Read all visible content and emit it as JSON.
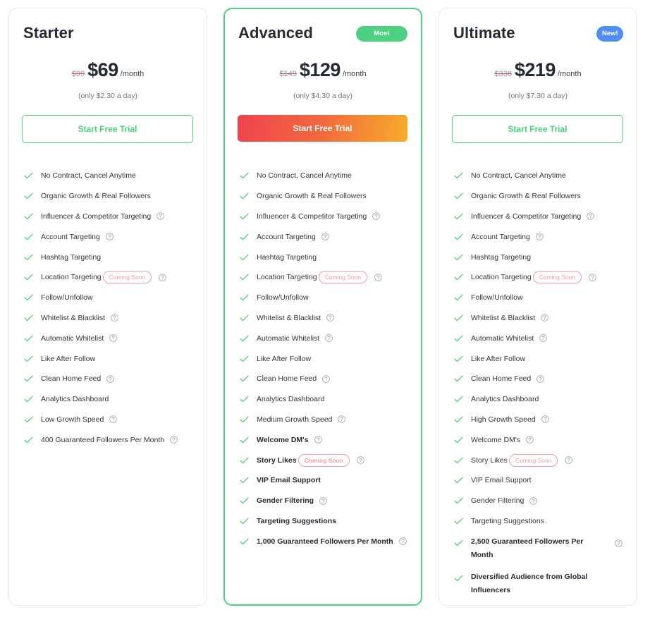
{
  "colors": {
    "accent_green": "#4cd180",
    "badge_blue": "#4f8ef7",
    "cta_gradient": [
      "#f0424f",
      "#f36a3c",
      "#f7ad2b"
    ],
    "coming_soon": "#f29aa3",
    "strike": "#e0445a"
  },
  "labels": {
    "coming_soon": "Coming Soon",
    "per_month": "/month",
    "cta": "Start Free Trial"
  },
  "plans": [
    {
      "name": "Starter",
      "badge": null,
      "old_price": "$99",
      "price": "$69",
      "per": "/month",
      "per_day": "(only $2.30 a day)",
      "cta": "Start Free Trial",
      "featured": false,
      "features": [
        {
          "text": "No Contract, Cancel Anytime",
          "bold": false,
          "help": false,
          "coming_soon": false
        },
        {
          "text": "Organic Growth & Real Followers",
          "bold": false,
          "help": false,
          "coming_soon": false
        },
        {
          "text": "Influencer & Competitor Targeting",
          "bold": false,
          "help": true,
          "coming_soon": false
        },
        {
          "text": "Account Targeting",
          "bold": false,
          "help": true,
          "coming_soon": false
        },
        {
          "text": "Hashtag Targeting",
          "bold": false,
          "help": false,
          "coming_soon": false
        },
        {
          "text": "Location Targeting",
          "bold": false,
          "help": true,
          "coming_soon": true
        },
        {
          "text": "Follow/Unfollow",
          "bold": false,
          "help": false,
          "coming_soon": false
        },
        {
          "text": "Whitelist & Blacklist",
          "bold": false,
          "help": true,
          "coming_soon": false
        },
        {
          "text": "Automatic Whitelist",
          "bold": false,
          "help": true,
          "coming_soon": false
        },
        {
          "text": "Like After Follow",
          "bold": false,
          "help": false,
          "coming_soon": false
        },
        {
          "text": "Clean Home Feed",
          "bold": false,
          "help": true,
          "coming_soon": false
        },
        {
          "text": "Analytics Dashboard",
          "bold": false,
          "help": false,
          "coming_soon": false
        },
        {
          "text": "Low Growth Speed",
          "bold": false,
          "help": true,
          "coming_soon": false
        },
        {
          "text": "400 Guaranteed Followers Per Month",
          "bold": false,
          "help": true,
          "coming_soon": false
        }
      ]
    },
    {
      "name": "Advanced",
      "badge": {
        "text": "Most popular",
        "type": "popular"
      },
      "old_price": "$149",
      "price": "$129",
      "per": "/month",
      "per_day": "(only $4.30 a day)",
      "cta": "Start Free Trial",
      "featured": true,
      "features": [
        {
          "text": "No Contract, Cancel Anytime",
          "bold": false,
          "help": false,
          "coming_soon": false
        },
        {
          "text": "Organic Growth & Real Followers",
          "bold": false,
          "help": false,
          "coming_soon": false
        },
        {
          "text": "Influencer & Competitor Targeting",
          "bold": false,
          "help": true,
          "coming_soon": false
        },
        {
          "text": "Account Targeting",
          "bold": false,
          "help": true,
          "coming_soon": false
        },
        {
          "text": "Hashtag Targeting",
          "bold": false,
          "help": false,
          "coming_soon": false
        },
        {
          "text": "Location Targeting",
          "bold": false,
          "help": true,
          "coming_soon": true
        },
        {
          "text": "Follow/Unfollow",
          "bold": false,
          "help": false,
          "coming_soon": false
        },
        {
          "text": "Whitelist & Blacklist",
          "bold": false,
          "help": true,
          "coming_soon": false
        },
        {
          "text": "Automatic Whitelist",
          "bold": false,
          "help": true,
          "coming_soon": false
        },
        {
          "text": "Like After Follow",
          "bold": false,
          "help": false,
          "coming_soon": false
        },
        {
          "text": "Clean Home Feed",
          "bold": false,
          "help": true,
          "coming_soon": false
        },
        {
          "text": "Analytics Dashboard",
          "bold": false,
          "help": false,
          "coming_soon": false
        },
        {
          "text": "Medium Growth Speed",
          "bold": false,
          "help": true,
          "coming_soon": false
        },
        {
          "text": "Welcome DM's",
          "bold": true,
          "help": true,
          "coming_soon": false
        },
        {
          "text": "Story Likes",
          "bold": true,
          "help": true,
          "coming_soon": true
        },
        {
          "text": "VIP Email Support",
          "bold": true,
          "help": false,
          "coming_soon": false
        },
        {
          "text": "Gender Filtering",
          "bold": true,
          "help": true,
          "coming_soon": false
        },
        {
          "text": "Targeting Suggestions",
          "bold": true,
          "help": false,
          "coming_soon": false
        },
        {
          "text": "1,000 Guaranteed Followers Per Month",
          "bold": true,
          "help": true,
          "coming_soon": false
        }
      ]
    },
    {
      "name": "Ultimate",
      "badge": {
        "text": "New!",
        "type": "new"
      },
      "old_price": "$338",
      "price": "$219",
      "per": "/month",
      "per_day": "(only $7.30 a day)",
      "cta": "Start Free Trial",
      "featured": false,
      "features": [
        {
          "text": "No Contract, Cancel Anytime",
          "bold": false,
          "help": false,
          "coming_soon": false
        },
        {
          "text": "Organic Growth & Real Followers",
          "bold": false,
          "help": false,
          "coming_soon": false
        },
        {
          "text": "Influencer & Competitor Targeting",
          "bold": false,
          "help": true,
          "coming_soon": false
        },
        {
          "text": "Account Targeting",
          "bold": false,
          "help": true,
          "coming_soon": false
        },
        {
          "text": "Hashtag Targeting",
          "bold": false,
          "help": false,
          "coming_soon": false
        },
        {
          "text": "Location Targeting",
          "bold": false,
          "help": true,
          "coming_soon": true
        },
        {
          "text": "Follow/Unfollow",
          "bold": false,
          "help": false,
          "coming_soon": false
        },
        {
          "text": "Whitelist & Blacklist",
          "bold": false,
          "help": true,
          "coming_soon": false
        },
        {
          "text": "Automatic Whitelist",
          "bold": false,
          "help": true,
          "coming_soon": false
        },
        {
          "text": "Like After Follow",
          "bold": false,
          "help": false,
          "coming_soon": false
        },
        {
          "text": "Clean Home Feed",
          "bold": false,
          "help": true,
          "coming_soon": false
        },
        {
          "text": "Analytics Dashboard",
          "bold": false,
          "help": false,
          "coming_soon": false
        },
        {
          "text": "High Growth Speed",
          "bold": false,
          "help": true,
          "coming_soon": false
        },
        {
          "text": "Welcome DM's",
          "bold": false,
          "help": true,
          "coming_soon": false
        },
        {
          "text": "Story Likes",
          "bold": false,
          "help": true,
          "coming_soon": true
        },
        {
          "text": "VIP Email Support",
          "bold": false,
          "help": false,
          "coming_soon": false
        },
        {
          "text": "Gender Filtering",
          "bold": false,
          "help": true,
          "coming_soon": false
        },
        {
          "text": "Targeting Suggestions",
          "bold": false,
          "help": false,
          "coming_soon": false
        },
        {
          "text": "2,500 Guaranteed Followers Per Month",
          "bold": true,
          "help": true,
          "coming_soon": false,
          "multiline": true
        },
        {
          "text": "Diversified Audience from Global Influencers",
          "bold": true,
          "help": false,
          "coming_soon": false,
          "multiline": true
        }
      ]
    }
  ]
}
